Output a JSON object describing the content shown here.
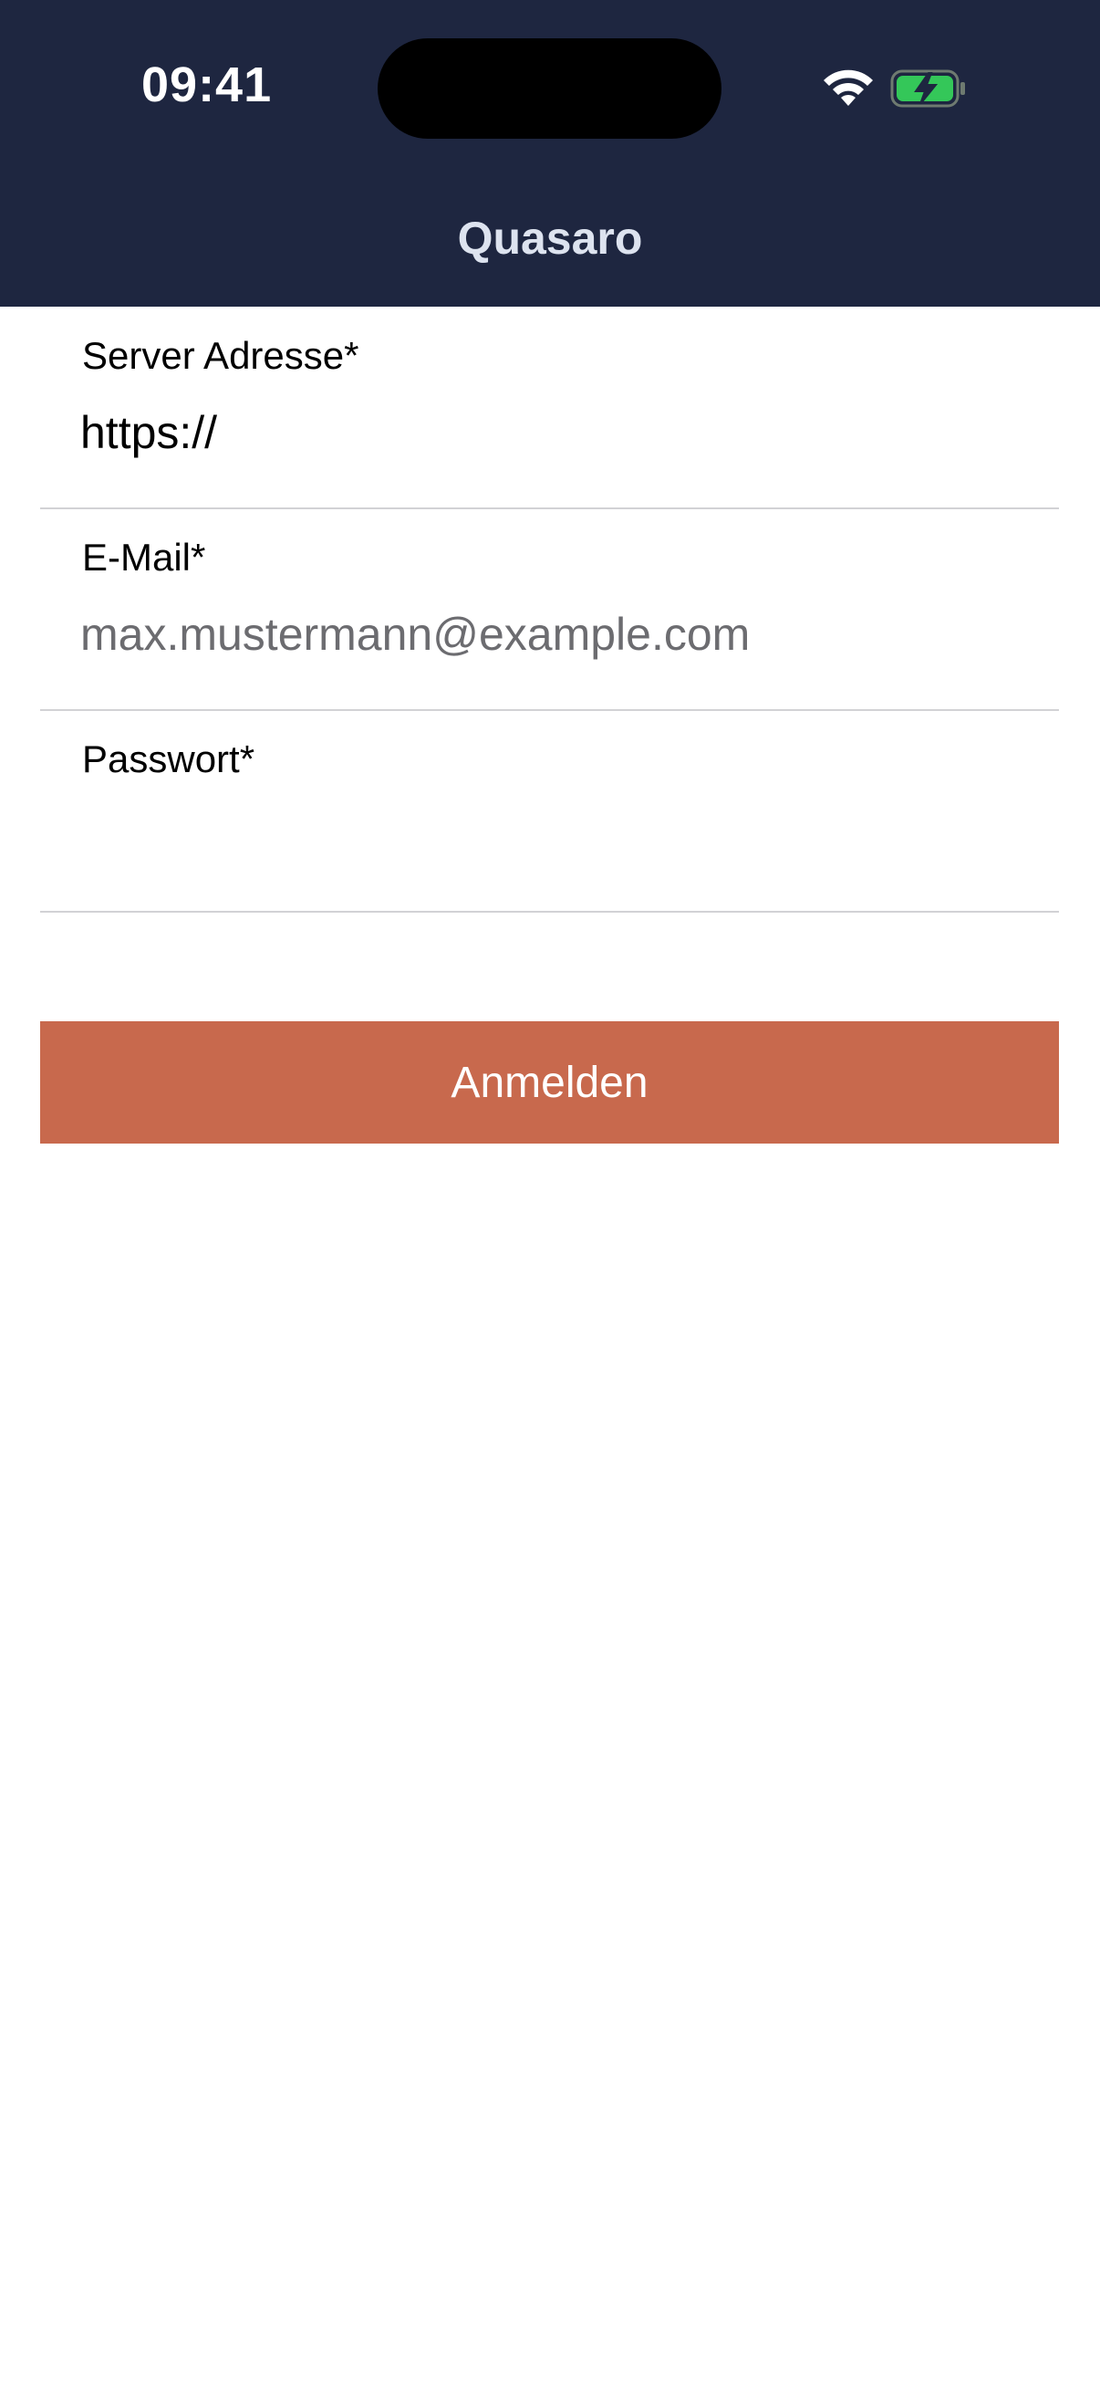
{
  "status_bar": {
    "time": "09:41",
    "wifi_icon": "wifi-icon",
    "battery_icon": "battery-charging-icon",
    "battery_color": "#34c759"
  },
  "header": {
    "title": "Quasaro",
    "background": "#1e2640"
  },
  "form": {
    "server": {
      "label": "Server Adresse*",
      "value": "https://"
    },
    "email": {
      "label": "E-Mail*",
      "placeholder": "max.mustermann@example.com"
    },
    "password": {
      "label": "Passwort*",
      "value": ""
    },
    "submit": {
      "label": "Anmelden",
      "color": "#c8694d"
    }
  }
}
